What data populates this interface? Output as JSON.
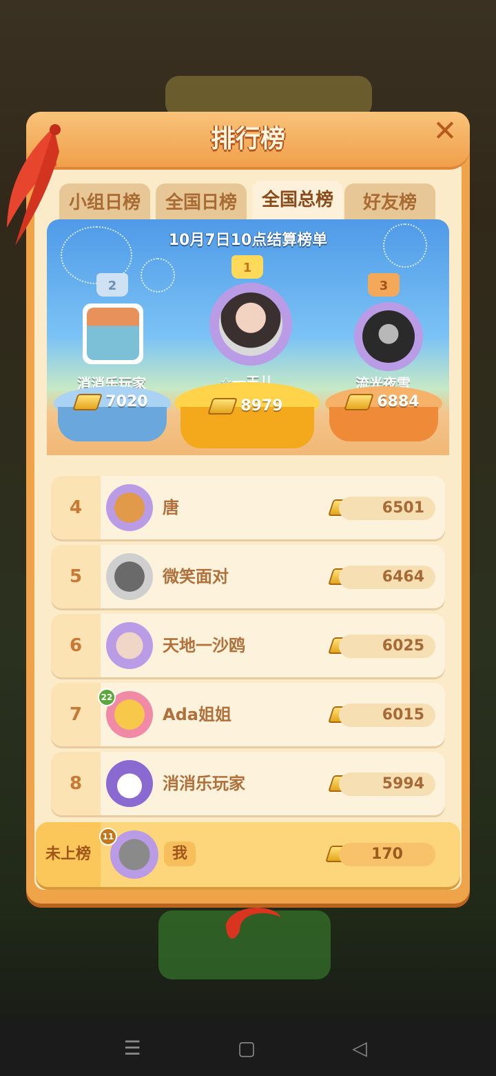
{
  "header": {
    "title": "排行榜",
    "close_icon": "close-icon"
  },
  "tabs": [
    {
      "label": "小组日榜",
      "active": false
    },
    {
      "label": "全国日榜",
      "active": false
    },
    {
      "label": "全国总榜",
      "active": true
    },
    {
      "label": "好友榜",
      "active": false
    }
  ],
  "podium": {
    "title": "10月7日10点结算榜单",
    "first": {
      "rank": "1",
      "name": "☆一玉儿",
      "score": "8979"
    },
    "second": {
      "rank": "2",
      "name": "消消乐玩家",
      "score": "7020"
    },
    "third": {
      "rank": "3",
      "name": "流光夜雪",
      "score": "6884"
    }
  },
  "list": [
    {
      "rank": "4",
      "name": "唐",
      "score": "6501"
    },
    {
      "rank": "5",
      "name": "微笑面对",
      "score": "6464"
    },
    {
      "rank": "6",
      "name": "天地一沙鸥",
      "score": "6025"
    },
    {
      "rank": "7",
      "name": "Ada姐姐",
      "score": "6015",
      "level": "22"
    },
    {
      "rank": "8",
      "name": "消消乐玩家",
      "score": "5994"
    }
  ],
  "me": {
    "rank": "未上榜",
    "name": "我",
    "score": "170",
    "level": "11"
  },
  "colors": {
    "panel": "#f0a44a",
    "row_bg": "#fdf3dc",
    "me_bg": "#fdd57a",
    "rank_text": "#c87a35"
  },
  "navbar": {
    "menu_icon": "menu-icon",
    "home_icon": "home-icon",
    "back_icon": "back-icon"
  }
}
